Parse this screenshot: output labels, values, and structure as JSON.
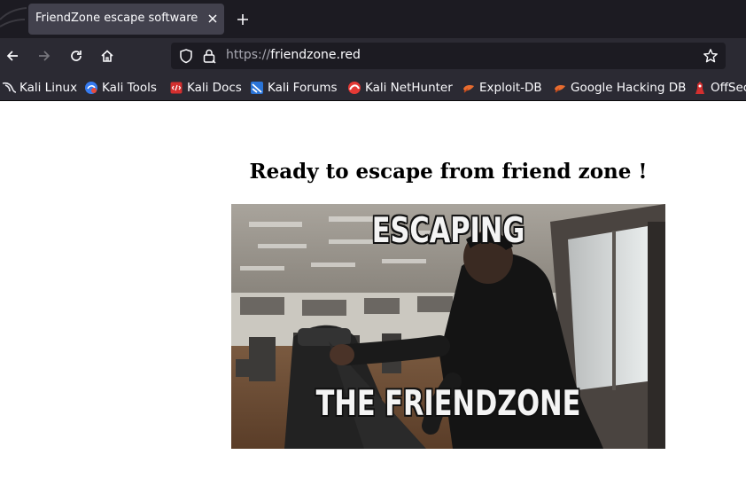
{
  "browser": {
    "tab": {
      "title": "FriendZone escape software",
      "close_icon": "close-icon"
    },
    "new_tab_icon": "plus-icon",
    "nav": {
      "back_icon": "arrow-left-icon",
      "forward_icon": "arrow-right-icon",
      "reload_icon": "reload-icon",
      "home_icon": "home-icon"
    },
    "urlbar": {
      "scheme": "https://",
      "host": "friendzone.red",
      "shield_icon": "shield-icon",
      "lock_icon": "lock-icon",
      "bookmark_icon": "star-icon"
    },
    "bookmarks": [
      {
        "label": "Kali Linux",
        "icon": "kali-dragon-icon"
      },
      {
        "label": "Kali Tools",
        "icon": "kali-tools-icon"
      },
      {
        "label": "Kali Docs",
        "icon": "kali-docs-icon"
      },
      {
        "label": "Kali Forums",
        "icon": "kali-forums-icon"
      },
      {
        "label": "Kali NetHunter",
        "icon": "nethunter-icon"
      },
      {
        "label": "Exploit-DB",
        "icon": "exploit-db-icon"
      },
      {
        "label": "Google Hacking DB",
        "icon": "ghdb-icon"
      },
      {
        "label": "OffSec",
        "icon": "offsec-icon"
      }
    ]
  },
  "page": {
    "heading": "Ready to escape from friend zone !",
    "gif": {
      "top_text": "ESCAPING",
      "bottom_text": "THE FRIENDZONE"
    }
  },
  "colors": {
    "tabstrip": "#1c1b22",
    "toolbar": "#2b2a33",
    "tab_active": "#42414d",
    "text_light": "#fbfbfe"
  }
}
